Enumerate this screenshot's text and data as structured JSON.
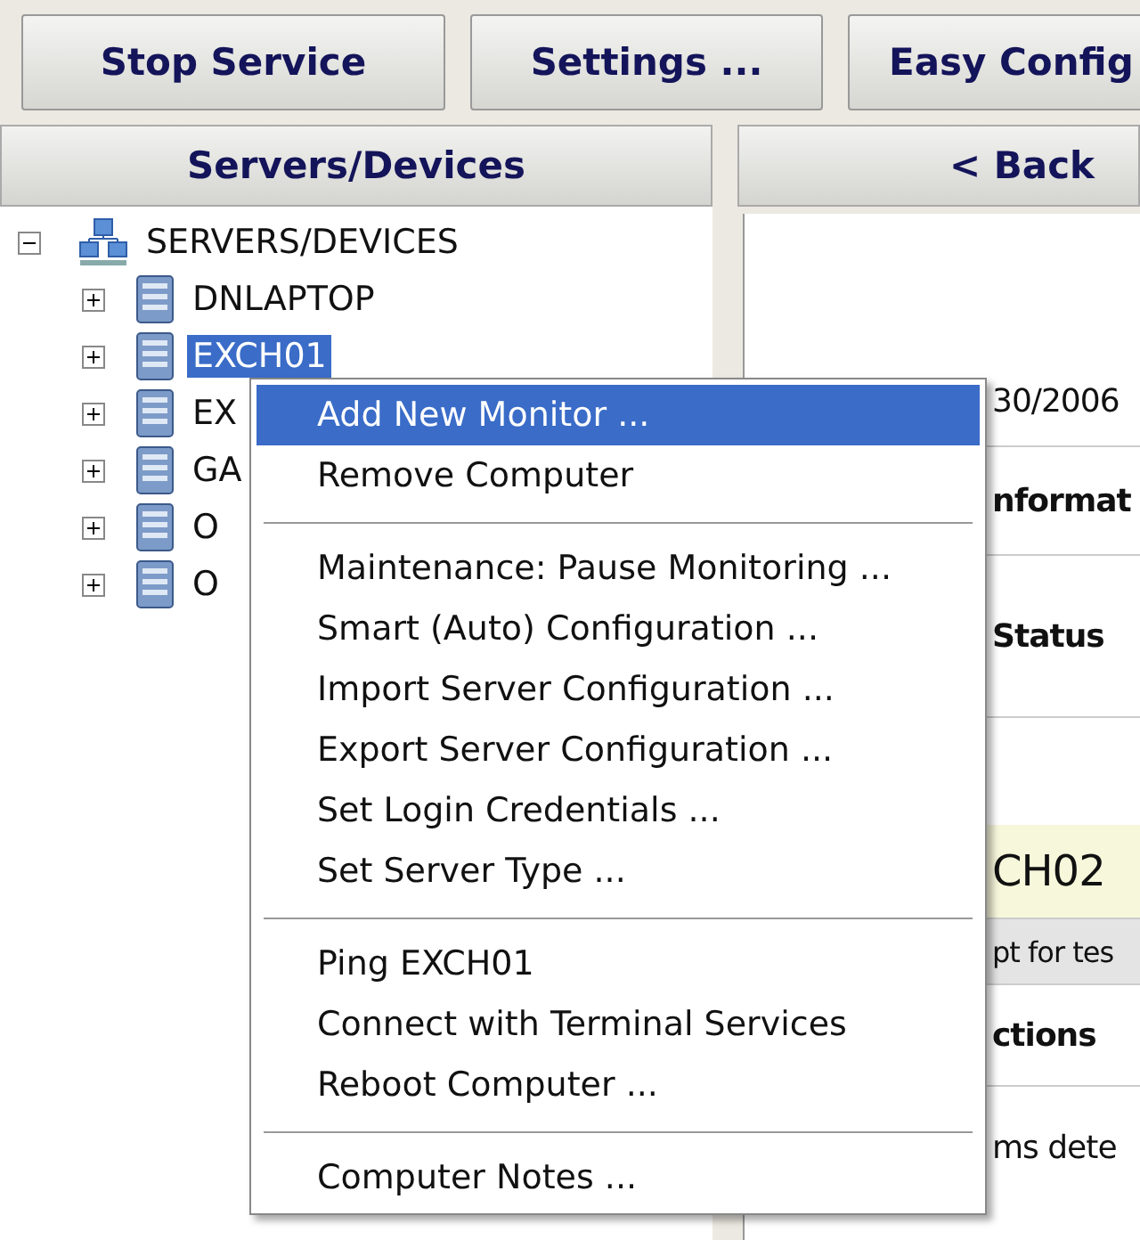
{
  "toolbar": {
    "buttons": [
      "Stop Service",
      "Settings ...",
      "Easy Config"
    ]
  },
  "left_panel": {
    "header": "Servers/Devices",
    "tree": {
      "label": "SERVERS/DEVICES",
      "expanded": true,
      "children": [
        {
          "label": "DNLAPTOP",
          "expanded": false,
          "selected": false
        },
        {
          "label": "EXCH01",
          "expanded": false,
          "selected": true
        },
        {
          "label": "EX",
          "expanded": false,
          "selected": false
        },
        {
          "label": "GA",
          "expanded": false,
          "selected": false
        },
        {
          "label": "O",
          "expanded": false,
          "selected": false
        },
        {
          "label": "O",
          "expanded": false,
          "selected": false
        }
      ]
    }
  },
  "right_panel": {
    "back_button": "< Back",
    "rows": [
      {
        "kind": "text",
        "text": "30/2006"
      },
      {
        "kind": "heading",
        "text": "nformat"
      },
      {
        "kind": "heading",
        "text": "Status"
      },
      {
        "kind": "highlight",
        "text": "CH02"
      },
      {
        "kind": "note",
        "text": "pt for tes"
      },
      {
        "kind": "heading",
        "text": "ctions"
      },
      {
        "kind": "text",
        "text": "ms dete"
      }
    ]
  },
  "context_menu": {
    "groups": [
      [
        {
          "label": "Add New Monitor ...",
          "selected": true
        },
        {
          "label": "Remove Computer",
          "selected": false
        }
      ],
      [
        {
          "label": "Maintenance: Pause Monitoring ...",
          "selected": false
        },
        {
          "label": "Smart (Auto) Configuration ...",
          "selected": false
        },
        {
          "label": "Import Server Configuration ...",
          "selected": false
        },
        {
          "label": "Export Server Configuration ...",
          "selected": false
        },
        {
          "label": "Set Login Credentials ...",
          "selected": false
        },
        {
          "label": "Set Server Type ...",
          "selected": false
        }
      ],
      [
        {
          "label": "Ping EXCH01",
          "selected": false
        },
        {
          "label": "Connect with Terminal Services",
          "selected": false
        },
        {
          "label": "Reboot Computer ...",
          "selected": false
        }
      ],
      [
        {
          "label": "Computer Notes ...",
          "selected": false
        }
      ]
    ]
  }
}
